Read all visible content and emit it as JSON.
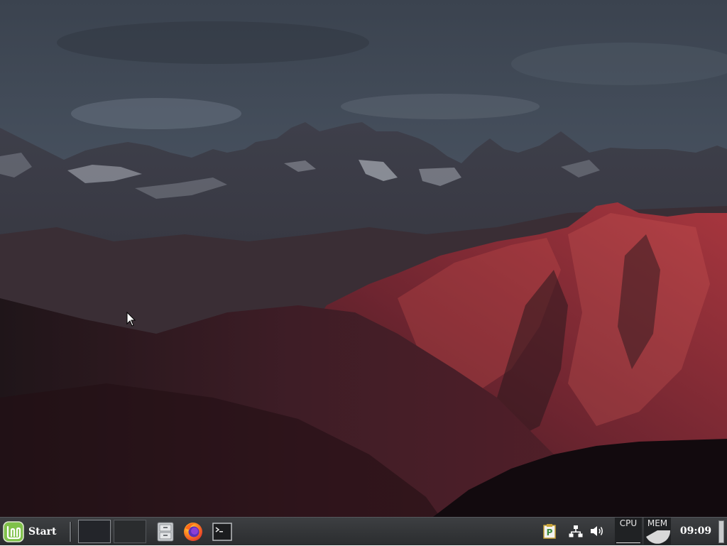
{
  "desktop": {
    "wallpaper": "mountain-range-at-dusk"
  },
  "taskbar": {
    "start": {
      "label": "Start",
      "icon": "linux-mint-logo-icon",
      "accent": "#8fd14f"
    },
    "workspaces": [
      {
        "name": "workspace-1",
        "active": true
      },
      {
        "name": "workspace-2",
        "active": false
      }
    ],
    "launchers": [
      {
        "name": "file-manager",
        "icon": "file-cabinet-icon"
      },
      {
        "name": "firefox",
        "icon": "firefox-icon"
      },
      {
        "name": "terminal",
        "icon": "terminal-icon"
      }
    ],
    "tray": [
      {
        "name": "clipboard",
        "icon": "clipboard-p-icon"
      },
      {
        "name": "network",
        "icon": "network-icon"
      },
      {
        "name": "volume",
        "icon": "speaker-icon"
      }
    ],
    "monitors": {
      "cpu_label": "CPU",
      "mem_label": "MEM"
    },
    "clock": "09:09"
  }
}
